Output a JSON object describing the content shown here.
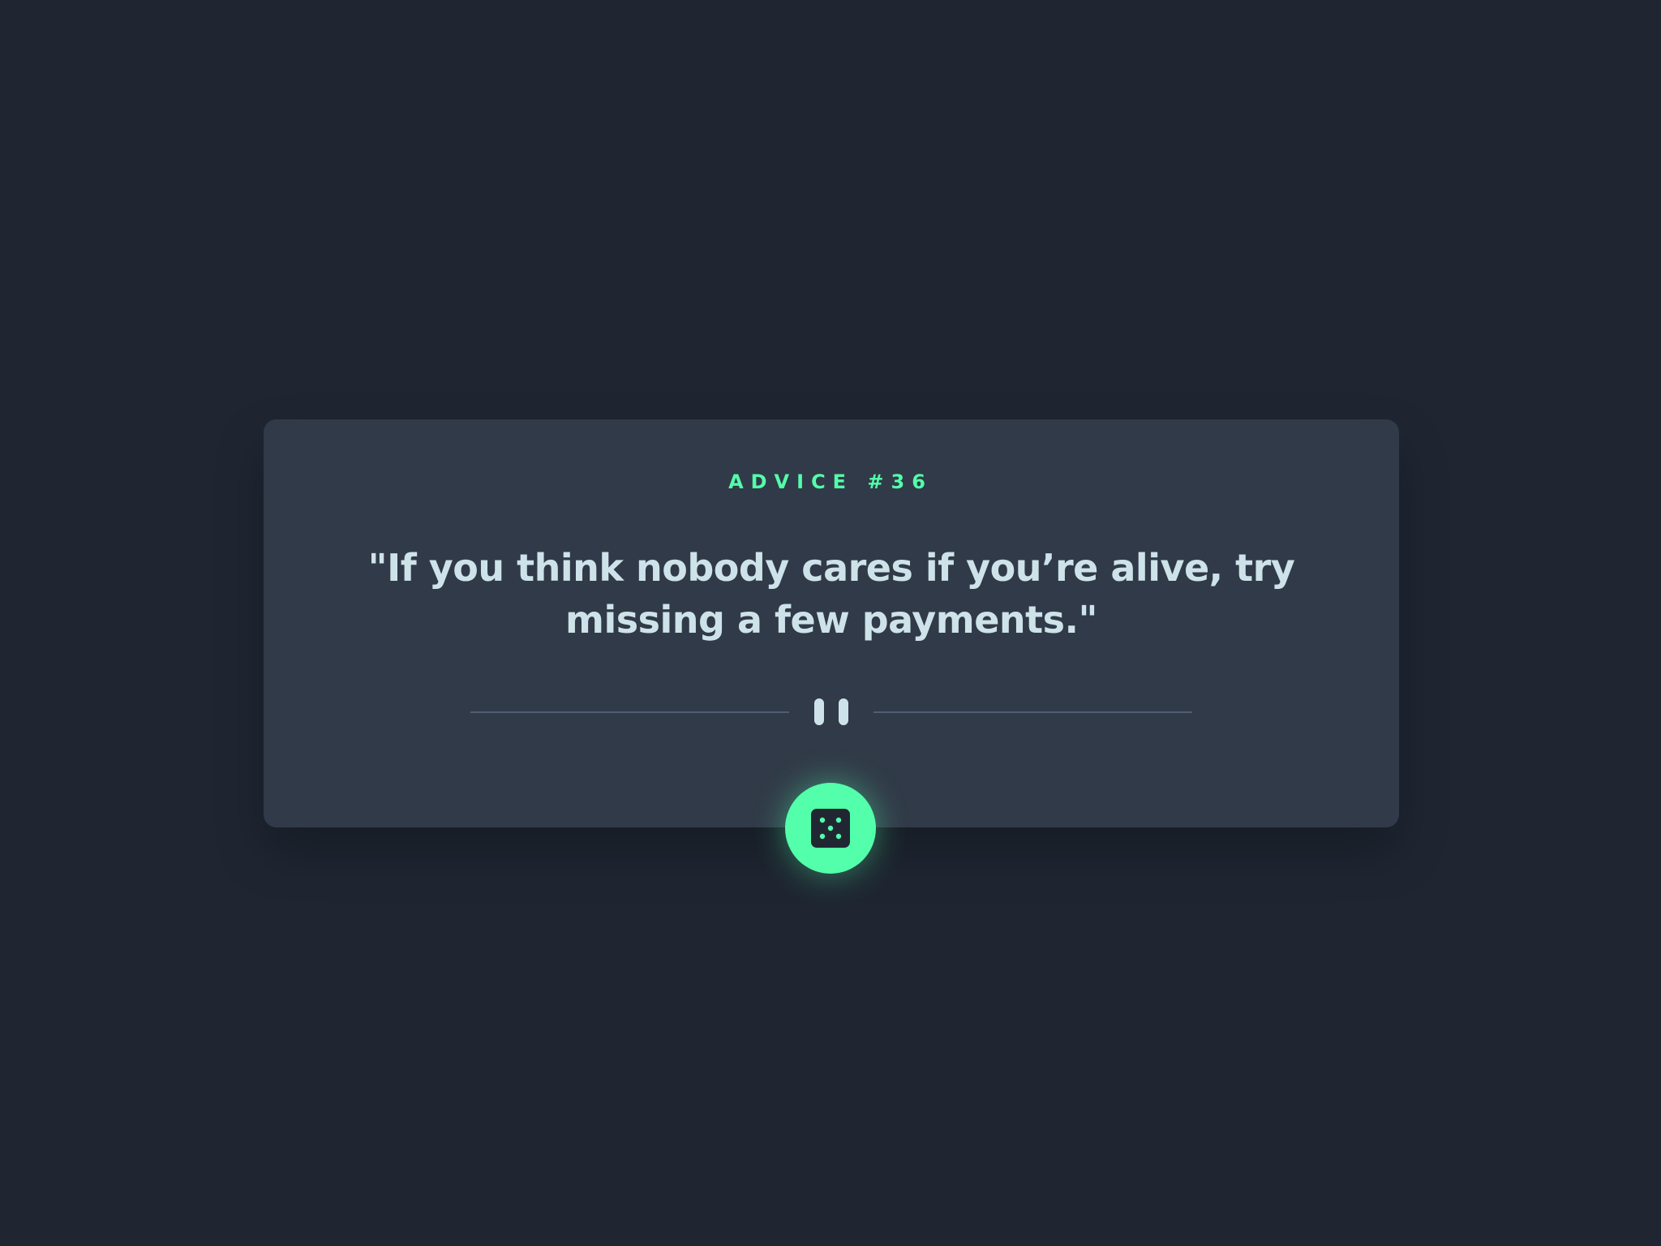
{
  "card": {
    "advice_label": "ADVICE #36",
    "quote": "\"If you think nobody cares if you’re alive, try missing a few payments.\""
  },
  "divider": {
    "icon": "pause-icon"
  },
  "dice_button": {
    "icon": "dice-icon"
  },
  "colors": {
    "background": "#1f2632",
    "card": "#313a48",
    "accent": "#53ffaa",
    "text": "#cee3e9",
    "divider_line": "#4f5d74"
  }
}
